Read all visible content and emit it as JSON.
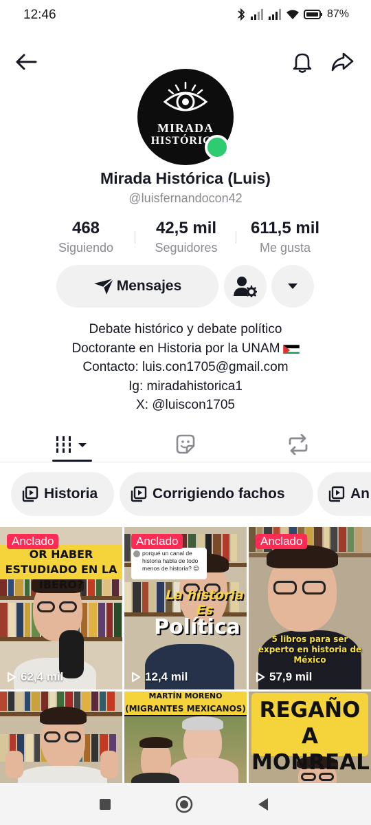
{
  "status_bar": {
    "time": "12:46",
    "battery": "87%"
  },
  "profile": {
    "avatar_text_line1": "MIRADA",
    "avatar_text_line2": "HISTÓRICA",
    "name": "Mirada Histórica (Luis)",
    "handle": "@luisfernandocon42"
  },
  "stats": [
    {
      "value": "468",
      "label": "Siguiendo"
    },
    {
      "value": "42,5 mil",
      "label": "Seguidores"
    },
    {
      "value": "611,5 mil",
      "label": "Me gusta"
    }
  ],
  "actions": {
    "message_label": "Mensajes"
  },
  "bio": {
    "line1": "Debate histórico y debate político",
    "line2": "Doctorante en Historia por la UNAM",
    "line3": "Contacto: luis.con1705@gmail.com",
    "line4": "Ig: miradahistorica1",
    "line5": "X: @luiscon1705"
  },
  "playlists": [
    {
      "label": "Historia"
    },
    {
      "label": "Corrigiendo fachos"
    },
    {
      "label": "An"
    }
  ],
  "videos": [
    {
      "pinned": "Anclado",
      "views": "62,4 mil",
      "overlay": "OR HABER ESTUDIADO EN LA IBERO?"
    },
    {
      "pinned": "Anclado",
      "views": "12,4 mil",
      "question": "porqué un canal de historia habla de todo menos de historia? 😊",
      "overlay_small": "La historia Es",
      "overlay_big": "Política"
    },
    {
      "pinned": "Anclado",
      "views": "57,9 mil",
      "overlay": "5 libros para ser experto en historia de México"
    },
    {
      "overlay": ""
    },
    {
      "overlay_top": "MARTÍN MORENO",
      "overlay": "(MIGRANTES MEXICANOS)"
    },
    {
      "overlay": "REGAÑO A MONREAL"
    }
  ],
  "colors": {
    "pinned_badge": "#fe2c55",
    "online_dot": "#2ecc71",
    "chip_bg": "#f1f1f2"
  }
}
